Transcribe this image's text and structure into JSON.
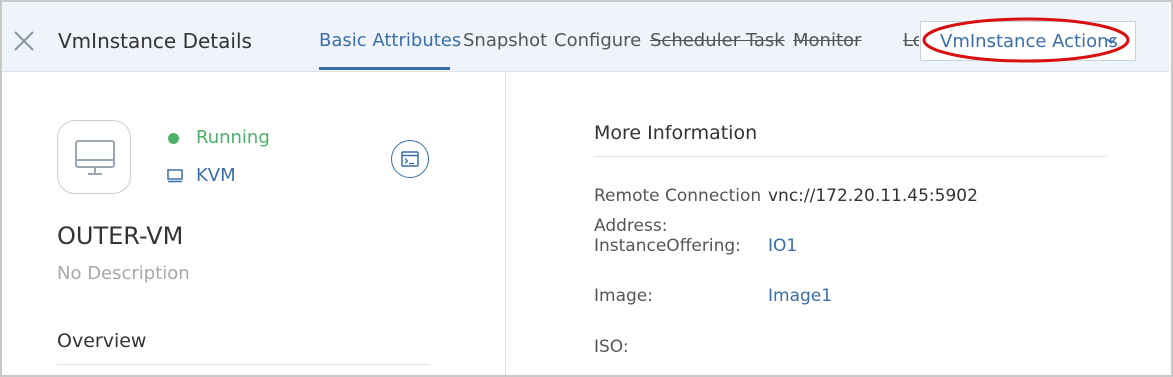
{
  "header": {
    "title": "VmInstance Details",
    "tabs": [
      {
        "label": "Basic Attributes",
        "state": "active"
      },
      {
        "label": "Snapshot"
      },
      {
        "label": "Configure"
      },
      {
        "label": "Scheduler Task",
        "state": "struck"
      },
      {
        "label": "Monitor",
        "state": "struck"
      },
      {
        "label": "Log",
        "state": "struck-clipped"
      }
    ],
    "actions_label": "VmInstance Actions",
    "close_icon": "close-icon"
  },
  "vm": {
    "status": "Running",
    "hypervisor": "KVM",
    "name": "OUTER-VM",
    "description": "No Description",
    "overview_heading": "Overview"
  },
  "more_info": {
    "title": "More Information",
    "rows": [
      {
        "label": "Remote Connection",
        "value": "vnc://172.20.11.45:5902"
      },
      {
        "label": "Address:",
        "value": ""
      },
      {
        "label": "InstanceOffering:",
        "value": "IO1"
      },
      {
        "label": "Image:",
        "value": "Image1"
      },
      {
        "label": "ISO:",
        "value": ""
      }
    ]
  },
  "colors": {
    "accent": "#3b6ea8",
    "running": "#4caf6a",
    "annotation": "#d81010",
    "header_bg": "#eef4fa"
  }
}
